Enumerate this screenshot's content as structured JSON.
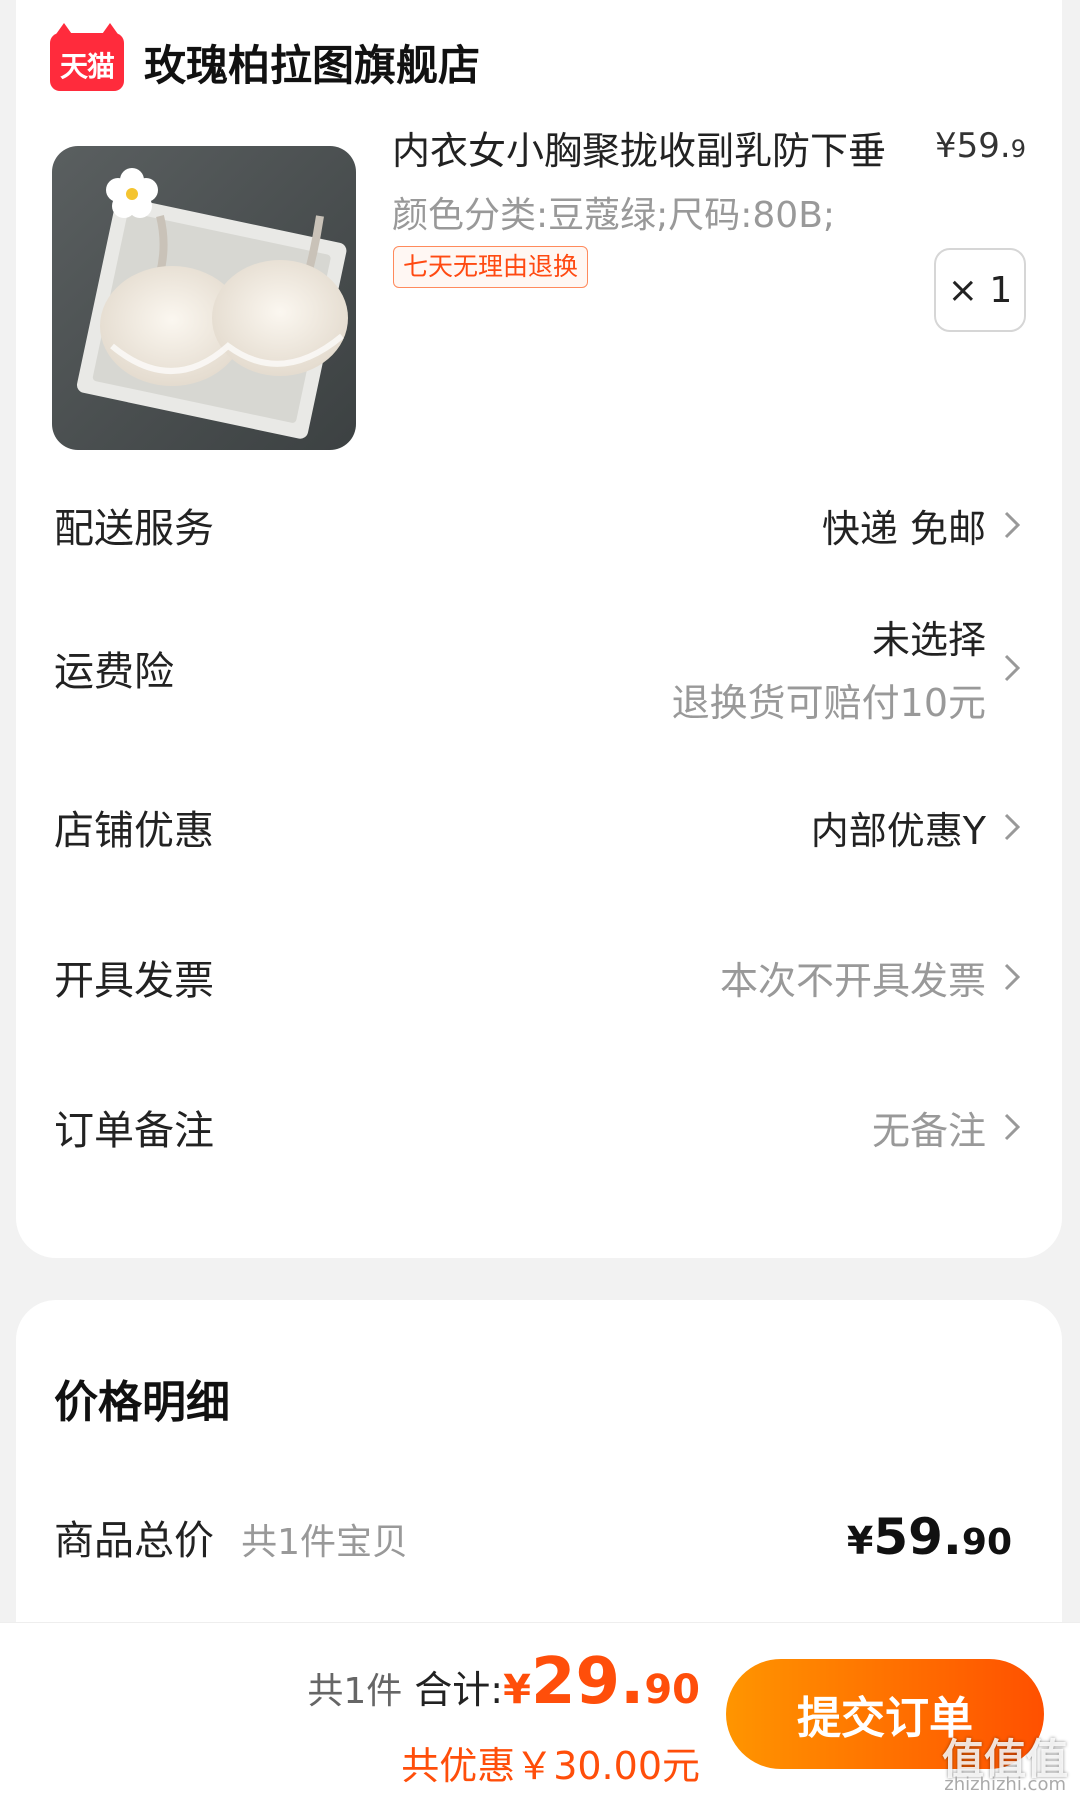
{
  "store": {
    "logo_text": "天猫",
    "name": "玫瑰柏拉图旗舰店"
  },
  "product": {
    "title": "内衣女小胸聚拢收副乳防下垂",
    "price_main": "¥59.",
    "price_decimal": "9",
    "spec": "颜色分类:豆蔻绿;尺码:80B;",
    "badge": "七天无理由退换",
    "quantity": "× 1",
    "image": "product-photo"
  },
  "rows": {
    "delivery": {
      "label": "配送服务",
      "value": "快递 免邮"
    },
    "insurance": {
      "label": "运费险",
      "value": "未选择",
      "sub": "退换货可赔付10元"
    },
    "discount": {
      "label": "店铺优惠",
      "value": "内部优惠Y"
    },
    "invoice": {
      "label": "开具发票",
      "value": "本次不开具发票"
    },
    "remark": {
      "label": "订单备注",
      "value": "无备注"
    }
  },
  "price_detail": {
    "title": "价格明细",
    "goods_total_label": "商品总价",
    "goods_count": "共1件宝贝",
    "currency": "¥",
    "goods_total_int": "59.",
    "goods_total_dec": "90"
  },
  "bottom_bar": {
    "count": "共1件",
    "total_label": "合计:",
    "currency": "¥",
    "total_int": "29.",
    "total_dec": "90",
    "discount": "共优惠￥30.00元",
    "submit_label": "提交订单"
  },
  "watermark": {
    "text": "值值值",
    "site": "zhizhizhi.com"
  },
  "colors": {
    "accent": "#ff5000",
    "tmall_red": "#ff2b3c",
    "text_grey": "#999999"
  }
}
